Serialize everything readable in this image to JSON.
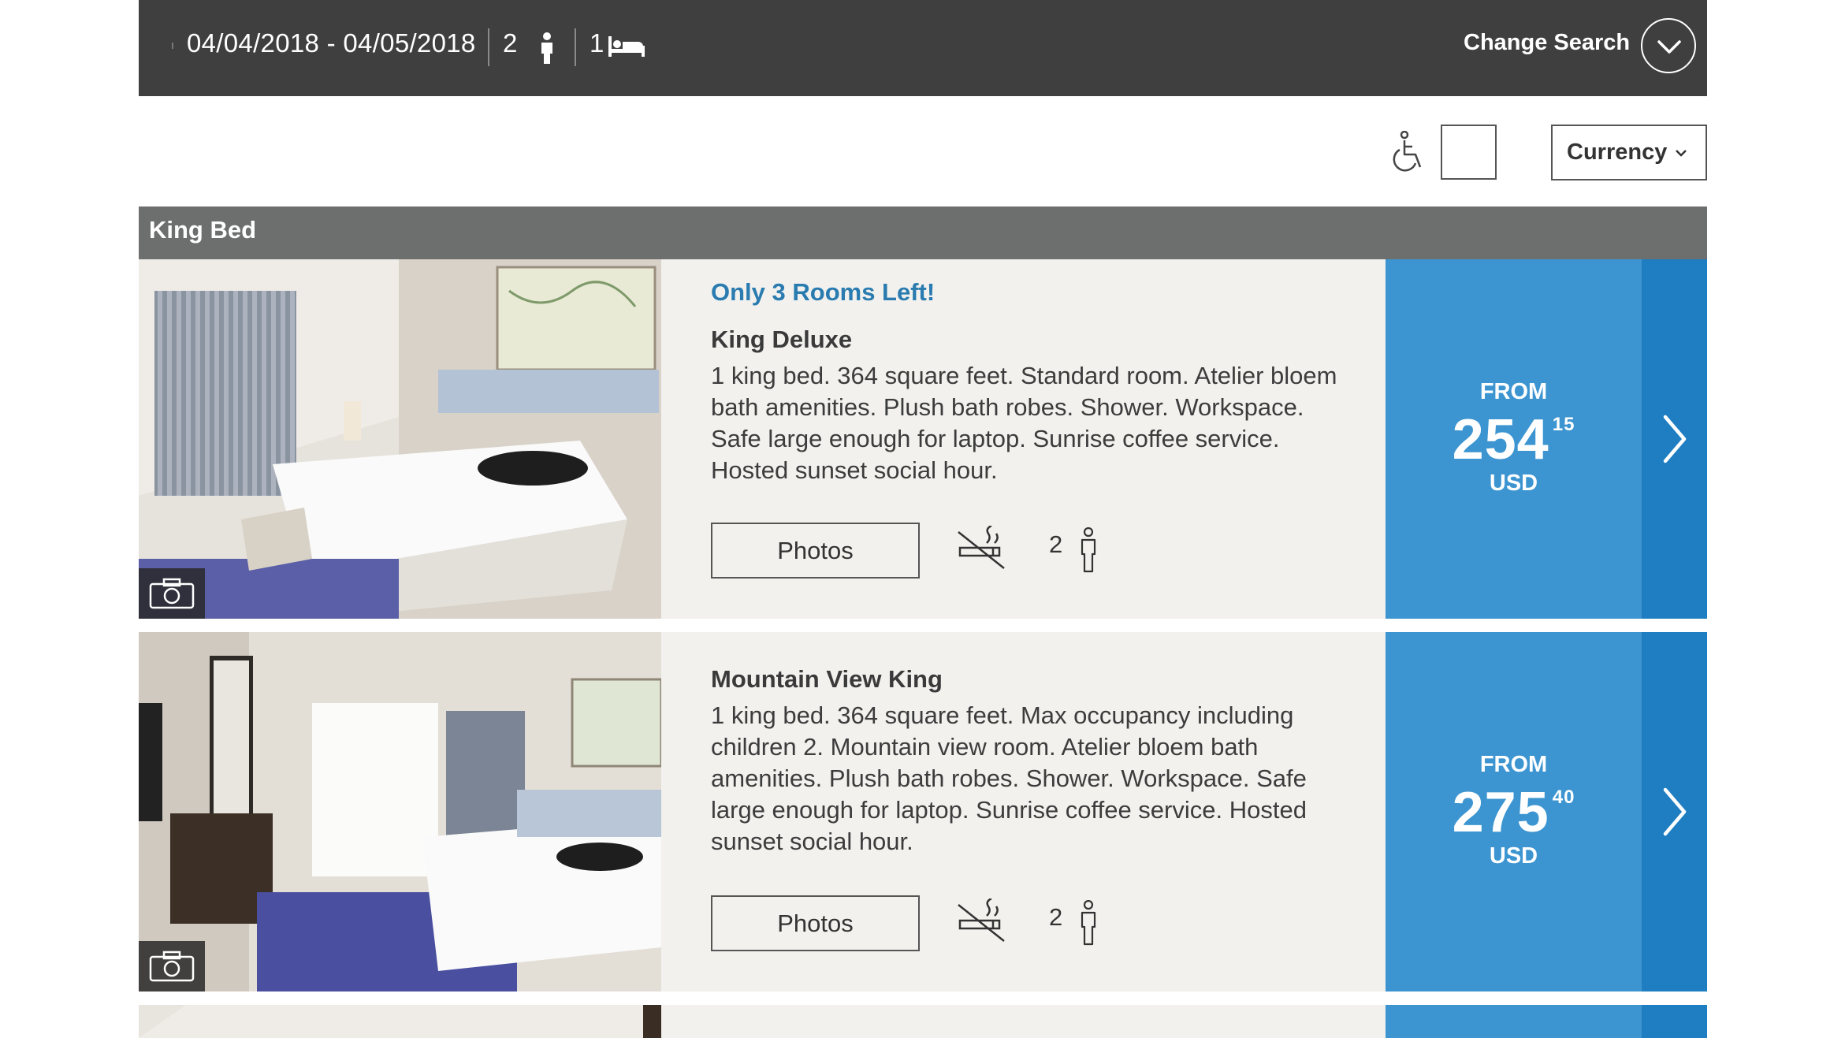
{
  "search": {
    "dates": "04/04/2018 - 04/05/2018",
    "guests": "2",
    "rooms": "1",
    "change_label": "Change Search"
  },
  "filters": {
    "currency_label": "Currency"
  },
  "section": {
    "title": "King Bed"
  },
  "rooms": [
    {
      "availability": "Only 3 Rooms Left!",
      "name": "King Deluxe",
      "description": "1 king bed. 364 square feet. Standard room. Atelier bloem bath amenities. Plush bath robes. Shower. Workspace. Safe large enough for laptop. Sunrise coffee service. Hosted sunset social hour.",
      "photos_label": "Photos",
      "occupancy": "2",
      "price_from": "FROM",
      "price_whole": "254",
      "price_cents": "15",
      "currency": "USD"
    },
    {
      "availability": "",
      "name": "Mountain View King",
      "description": "1 king bed. 364 square feet. Max occupancy including children 2. Mountain view room. Atelier bloem bath amenities. Plush bath robes. Shower. Workspace. Safe large enough for laptop. Sunrise coffee service. Hosted sunset social hour.",
      "photos_label": "Photos",
      "occupancy": "2",
      "price_from": "FROM",
      "price_whole": "275",
      "price_cents": "40",
      "currency": "USD"
    }
  ],
  "icons": {
    "person": "person-icon",
    "bed": "bed-icon",
    "chevron_down": "chevron-down-icon",
    "wheelchair": "wheelchair-icon",
    "camera": "camera-icon",
    "no_smoking": "no-smoking-icon",
    "occupant": "occupant-icon",
    "chevron_right": "chevron-right-icon"
  },
  "colors": {
    "header_bar": "#3f3f3f",
    "section_header": "#6d6e6e",
    "card_bg": "#f2f1ee",
    "price_bg": "#3c95d1",
    "arrow_bg": "#1f7ec1",
    "accent_text": "#2a7bb0"
  }
}
